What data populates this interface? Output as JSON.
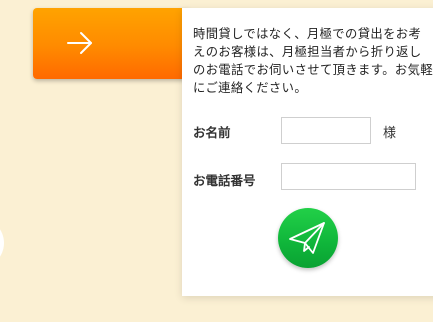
{
  "intro_text": "時間貸しではなく、月極での貸出をお考えのお客様は、月極担当者から折り返しのお電話でお伺いさせて頂きます。お気軽にご連絡ください。",
  "form": {
    "name_label": "お名前",
    "name_value": "",
    "name_suffix": "様",
    "phone_label": "お電話番号",
    "phone_value": ""
  },
  "icons": {
    "tab_icon": "arrow-right-icon",
    "submit_icon": "paper-plane-icon"
  },
  "colors": {
    "page_background": "#fbf0d3",
    "tab_orange": "#ff8a00",
    "submit_green": "#12b83c"
  }
}
